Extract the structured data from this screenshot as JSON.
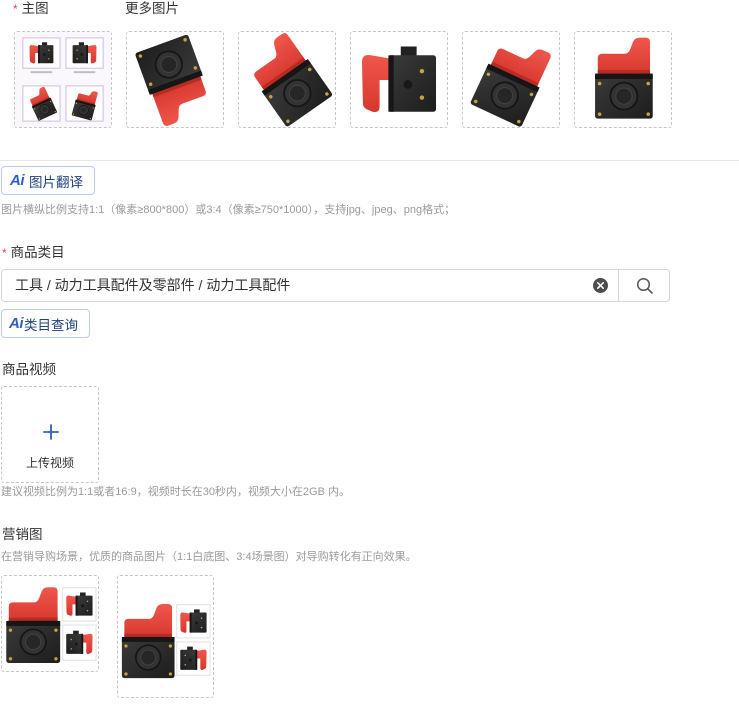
{
  "main_image": {
    "required_mark": "*",
    "label": "主图"
  },
  "more_images_label": "更多图片",
  "translate_button": {
    "ai_badge": "Ai",
    "label": "图片翻译"
  },
  "image_hint": "图片横纵比例支持1:1（像素≥800*800）或3:4（像素≥750*1000），支持jpg、jpeg、png格式；",
  "category": {
    "required_mark": "*",
    "label": "商品类目",
    "value": "工具 / 动力工具配件及零部件 / 动力工具配件"
  },
  "category_query_button": {
    "ai_badge": "Ai",
    "label": "类目查询"
  },
  "video": {
    "label": "商品视频",
    "upload_label": "上传视频",
    "hint": "建议视频比例为1:1或者16:9，视频时长在30秒内，视频大小在2GB 内。"
  },
  "marketing": {
    "label": "营销图",
    "hint": "在营销导购场景，优质的商品图片（1:1白底图、3:4场景图）对导购转化有正向效果。"
  },
  "icons": {
    "clear": "clear-icon",
    "search": "search-icon",
    "upload": "plus-icon",
    "ai": "ai-badge-icon"
  },
  "colors": {
    "accent": "#2d5fc4",
    "required": "#e0464e",
    "hint_text": "#9a9a9a",
    "button_border": "#b9cbe8",
    "product_red": "#e8463f",
    "product_black": "#2b2b2b"
  }
}
